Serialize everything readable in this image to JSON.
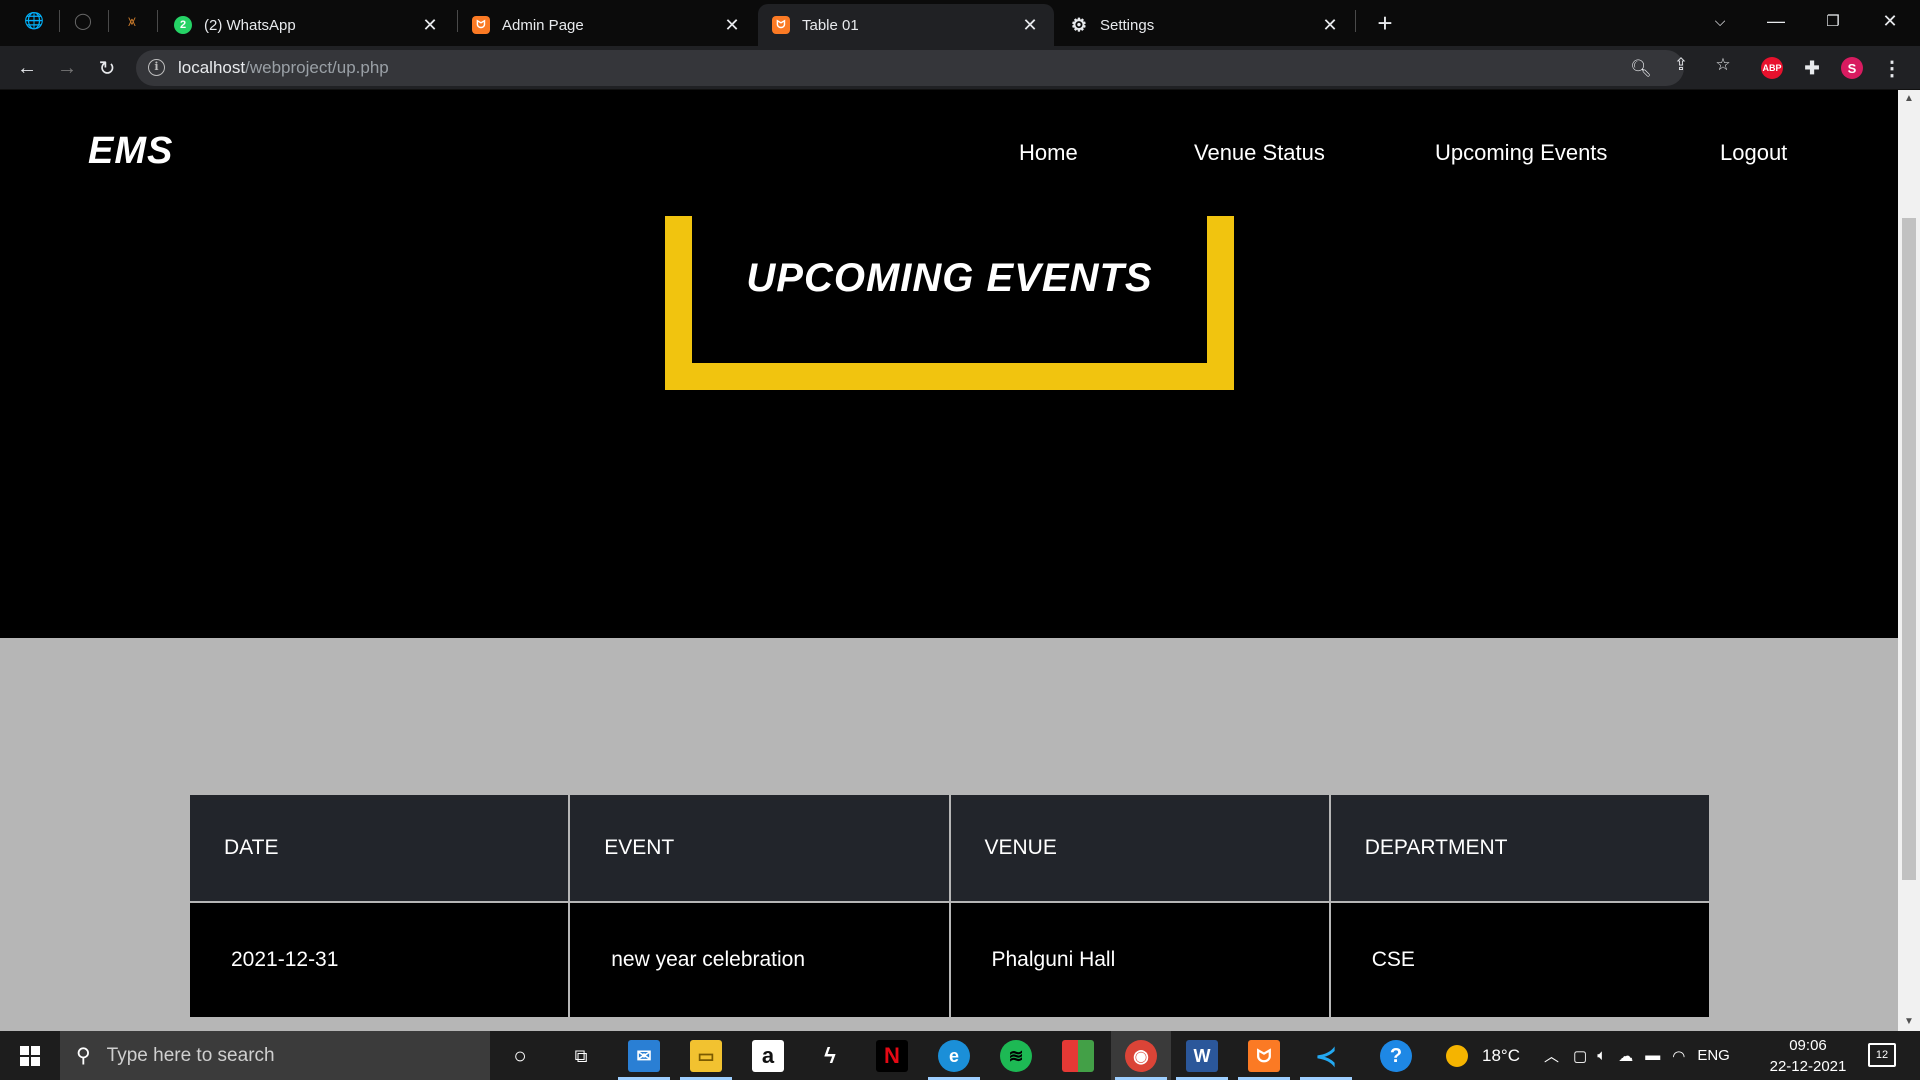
{
  "browser": {
    "tabs": [
      {
        "label": "(2) WhatsApp",
        "icon": "whatsapp-icon",
        "active": false
      },
      {
        "label": "Admin Page",
        "icon": "xampp-icon",
        "active": false
      },
      {
        "label": "Table 01",
        "icon": "xampp-icon",
        "active": true
      },
      {
        "label": "Settings",
        "icon": "gear-icon",
        "active": false
      }
    ],
    "whatsapp_badge": "2",
    "url_host": "localhost",
    "url_path": "/webproject/up.php",
    "profile_initial": "S",
    "abp_label": "ABP"
  },
  "site": {
    "brand": "EMS",
    "nav": [
      "Home",
      "Venue Status",
      "Upcoming Events",
      "Logout"
    ],
    "heading": "UPCOMING EVENTS",
    "accent_color": "#f1c40f"
  },
  "events_table": {
    "headers": [
      "DATE",
      "EVENT",
      "VENUE",
      "DEPARTMENT"
    ],
    "rows": [
      [
        "2021-12-31",
        "new year celebration",
        "Phalguni Hall",
        "CSE"
      ]
    ]
  },
  "taskbar": {
    "search_placeholder": "Type here to search",
    "temperature": "18°C",
    "language": "ENG",
    "time": "09:06",
    "date": "22-12-2021",
    "notification_count": "12"
  }
}
